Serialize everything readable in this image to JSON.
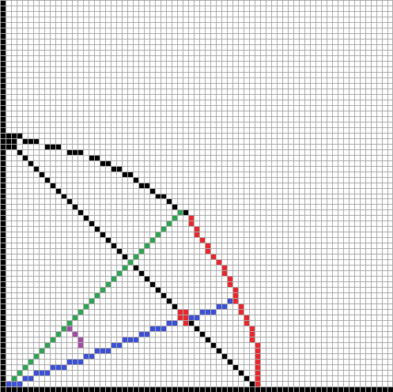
{
  "grid": {
    "columns": 71,
    "rows": 71,
    "background": "#ffffff",
    "line_color": "#a9a9a9"
  },
  "palette": {
    "black": "#000000",
    "red": "#e8262b",
    "green": "#2ea352",
    "blue": "#3a4fd6",
    "purple": "#a14aa6"
  },
  "layers": [
    {
      "name": "border-left",
      "color": "black",
      "cells": [
        [
          0,
          0
        ],
        [
          0,
          1
        ],
        [
          0,
          2
        ],
        [
          0,
          3
        ],
        [
          0,
          4
        ],
        [
          0,
          5
        ],
        [
          0,
          6
        ],
        [
          0,
          7
        ],
        [
          0,
          8
        ],
        [
          0,
          9
        ],
        [
          0,
          10
        ],
        [
          0,
          11
        ],
        [
          0,
          12
        ],
        [
          0,
          13
        ],
        [
          0,
          14
        ],
        [
          0,
          15
        ],
        [
          0,
          16
        ],
        [
          0,
          17
        ],
        [
          0,
          18
        ],
        [
          0,
          19
        ],
        [
          0,
          20
        ],
        [
          0,
          21
        ],
        [
          0,
          22
        ],
        [
          0,
          23
        ],
        [
          0,
          24
        ],
        [
          0,
          25
        ],
        [
          0,
          26
        ],
        [
          0,
          27
        ],
        [
          0,
          28
        ],
        [
          0,
          29
        ],
        [
          0,
          30
        ],
        [
          0,
          31
        ],
        [
          0,
          32
        ],
        [
          0,
          33
        ],
        [
          0,
          34
        ],
        [
          0,
          35
        ],
        [
          0,
          36
        ],
        [
          0,
          37
        ],
        [
          0,
          38
        ],
        [
          0,
          39
        ],
        [
          0,
          40
        ],
        [
          0,
          41
        ],
        [
          0,
          42
        ],
        [
          0,
          43
        ],
        [
          0,
          44
        ],
        [
          0,
          45
        ],
        [
          0,
          46
        ],
        [
          0,
          47
        ],
        [
          0,
          48
        ],
        [
          0,
          49
        ],
        [
          0,
          50
        ],
        [
          0,
          51
        ],
        [
          0,
          52
        ],
        [
          0,
          53
        ],
        [
          0,
          54
        ],
        [
          0,
          55
        ],
        [
          0,
          56
        ],
        [
          0,
          57
        ],
        [
          0,
          58
        ],
        [
          0,
          59
        ],
        [
          0,
          60
        ],
        [
          0,
          61
        ],
        [
          0,
          62
        ],
        [
          0,
          63
        ],
        [
          0,
          64
        ],
        [
          0,
          65
        ],
        [
          0,
          66
        ],
        [
          0,
          67
        ],
        [
          0,
          68
        ],
        [
          0,
          69
        ],
        [
          0,
          70
        ]
      ]
    },
    {
      "name": "border-bottom",
      "color": "black",
      "cells": [
        [
          1,
          70
        ],
        [
          2,
          70
        ],
        [
          3,
          70
        ],
        [
          4,
          70
        ],
        [
          5,
          70
        ],
        [
          6,
          70
        ],
        [
          7,
          70
        ],
        [
          8,
          70
        ],
        [
          9,
          70
        ],
        [
          10,
          70
        ],
        [
          11,
          70
        ],
        [
          12,
          70
        ],
        [
          13,
          70
        ],
        [
          14,
          70
        ],
        [
          15,
          70
        ],
        [
          16,
          70
        ],
        [
          17,
          70
        ],
        [
          18,
          70
        ],
        [
          19,
          70
        ],
        [
          20,
          70
        ],
        [
          21,
          70
        ],
        [
          22,
          70
        ],
        [
          23,
          70
        ],
        [
          24,
          70
        ],
        [
          25,
          70
        ],
        [
          26,
          70
        ],
        [
          27,
          70
        ],
        [
          28,
          70
        ],
        [
          29,
          70
        ],
        [
          30,
          70
        ],
        [
          31,
          70
        ],
        [
          32,
          70
        ],
        [
          33,
          70
        ],
        [
          34,
          70
        ],
        [
          35,
          70
        ],
        [
          36,
          70
        ],
        [
          37,
          70
        ],
        [
          38,
          70
        ],
        [
          39,
          70
        ],
        [
          40,
          70
        ],
        [
          41,
          70
        ],
        [
          42,
          70
        ],
        [
          43,
          70
        ],
        [
          44,
          70
        ],
        [
          45,
          70
        ],
        [
          46,
          70
        ],
        [
          47,
          70
        ],
        [
          48,
          70
        ],
        [
          49,
          70
        ],
        [
          50,
          70
        ],
        [
          51,
          70
        ],
        [
          52,
          70
        ],
        [
          53,
          70
        ],
        [
          54,
          70
        ],
        [
          55,
          70
        ],
        [
          56,
          70
        ],
        [
          57,
          70
        ],
        [
          58,
          70
        ],
        [
          59,
          70
        ],
        [
          60,
          70
        ],
        [
          61,
          70
        ],
        [
          62,
          70
        ],
        [
          63,
          70
        ],
        [
          64,
          70
        ],
        [
          65,
          70
        ],
        [
          66,
          70
        ],
        [
          67,
          70
        ],
        [
          68,
          70
        ],
        [
          69,
          70
        ],
        [
          70,
          70
        ]
      ]
    },
    {
      "name": "black-arc",
      "color": "black",
      "cells": [
        [
          1,
          24
        ],
        [
          2,
          24
        ],
        [
          3,
          24
        ],
        [
          1,
          25
        ],
        [
          2,
          25
        ],
        [
          4,
          25
        ],
        [
          5,
          25
        ],
        [
          6,
          25
        ],
        [
          8,
          26
        ],
        [
          9,
          26
        ],
        [
          10,
          26
        ],
        [
          12,
          27
        ],
        [
          13,
          27
        ],
        [
          14,
          27
        ],
        [
          16,
          28
        ],
        [
          17,
          28
        ],
        [
          18,
          29
        ],
        [
          19,
          29
        ],
        [
          20,
          30
        ],
        [
          21,
          30
        ],
        [
          22,
          31
        ],
        [
          23,
          31
        ],
        [
          24,
          32
        ],
        [
          25,
          33
        ],
        [
          26,
          33
        ],
        [
          27,
          34
        ],
        [
          28,
          35
        ],
        [
          29,
          35
        ],
        [
          30,
          36
        ],
        [
          31,
          37
        ],
        [
          32,
          38
        ],
        [
          33,
          38
        ]
      ]
    },
    {
      "name": "black-diagonal",
      "color": "black",
      "cells": [
        [
          1,
          26
        ],
        [
          2,
          26
        ],
        [
          3,
          27
        ],
        [
          4,
          28
        ],
        [
          5,
          29
        ],
        [
          6,
          30
        ],
        [
          7,
          31
        ],
        [
          8,
          32
        ],
        [
          9,
          33
        ],
        [
          10,
          34
        ],
        [
          11,
          35
        ],
        [
          12,
          36
        ],
        [
          13,
          37
        ],
        [
          14,
          38
        ],
        [
          15,
          39
        ],
        [
          16,
          40
        ],
        [
          17,
          41
        ],
        [
          18,
          42
        ],
        [
          19,
          43
        ],
        [
          20,
          44
        ],
        [
          21,
          45
        ],
        [
          22,
          46
        ],
        [
          23,
          47
        ],
        [
          24,
          48
        ],
        [
          25,
          49
        ],
        [
          26,
          50
        ],
        [
          27,
          51
        ],
        [
          28,
          52
        ],
        [
          29,
          53
        ],
        [
          30,
          54
        ],
        [
          31,
          55
        ],
        [
          32,
          56
        ],
        [
          33,
          57
        ],
        [
          34,
          58
        ],
        [
          35,
          59
        ],
        [
          36,
          60
        ],
        [
          37,
          61
        ],
        [
          38,
          62
        ],
        [
          39,
          63
        ],
        [
          40,
          64
        ],
        [
          41,
          65
        ],
        [
          42,
          66
        ],
        [
          43,
          67
        ],
        [
          44,
          68
        ],
        [
          45,
          69
        ]
      ]
    },
    {
      "name": "red-arc",
      "color": "red",
      "cells": [
        [
          34,
          39
        ],
        [
          34,
          40
        ],
        [
          35,
          41
        ],
        [
          35,
          42
        ],
        [
          36,
          43
        ],
        [
          37,
          44
        ],
        [
          37,
          45
        ],
        [
          38,
          46
        ],
        [
          39,
          47
        ],
        [
          40,
          48
        ],
        [
          40,
          49
        ],
        [
          41,
          50
        ],
        [
          41,
          51
        ],
        [
          42,
          52
        ],
        [
          42,
          53
        ],
        [
          42,
          54
        ],
        [
          43,
          55
        ],
        [
          43,
          56
        ],
        [
          44,
          57
        ],
        [
          44,
          58
        ],
        [
          45,
          59
        ],
        [
          45,
          60
        ],
        [
          45,
          61
        ],
        [
          46,
          62
        ],
        [
          46,
          63
        ],
        [
          46,
          64
        ],
        [
          46,
          65
        ],
        [
          46,
          66
        ],
        [
          46,
          67
        ],
        [
          46,
          68
        ],
        [
          46,
          69
        ],
        [
          32,
          56
        ],
        [
          33,
          56
        ],
        [
          32,
          57
        ],
        [
          33,
          57
        ],
        [
          34,
          57
        ],
        [
          33,
          58
        ]
      ]
    },
    {
      "name": "green-line",
      "color": "green",
      "cells": [
        [
          32,
          38
        ],
        [
          31,
          39
        ],
        [
          30,
          40
        ],
        [
          29,
          41
        ],
        [
          28,
          42
        ],
        [
          27,
          43
        ],
        [
          26,
          44
        ],
        [
          25,
          45
        ],
        [
          24,
          46
        ],
        [
          23,
          47
        ],
        [
          22,
          48
        ],
        [
          21,
          49
        ],
        [
          20,
          50
        ],
        [
          19,
          51
        ],
        [
          18,
          52
        ],
        [
          17,
          53
        ],
        [
          16,
          54
        ],
        [
          15,
          55
        ],
        [
          14,
          56
        ],
        [
          13,
          57
        ],
        [
          12,
          58
        ],
        [
          11,
          59
        ],
        [
          10,
          60
        ],
        [
          9,
          61
        ],
        [
          8,
          62
        ],
        [
          7,
          63
        ],
        [
          6,
          64
        ],
        [
          5,
          65
        ],
        [
          4,
          66
        ],
        [
          3,
          67
        ],
        [
          2,
          68
        ],
        [
          1,
          69
        ]
      ]
    },
    {
      "name": "blue-line",
      "color": "blue",
      "cells": [
        [
          41,
          54
        ],
        [
          40,
          55
        ],
        [
          39,
          55
        ],
        [
          38,
          56
        ],
        [
          37,
          56
        ],
        [
          36,
          56
        ],
        [
          35,
          57
        ],
        [
          34,
          57
        ],
        [
          31,
          58
        ],
        [
          30,
          58
        ],
        [
          29,
          59
        ],
        [
          28,
          59
        ],
        [
          27,
          59
        ],
        [
          26,
          60
        ],
        [
          25,
          60
        ],
        [
          24,
          61
        ],
        [
          23,
          61
        ],
        [
          22,
          61
        ],
        [
          21,
          62
        ],
        [
          20,
          62
        ],
        [
          19,
          63
        ],
        [
          18,
          63
        ],
        [
          17,
          63
        ],
        [
          16,
          64
        ],
        [
          15,
          64
        ],
        [
          14,
          65
        ],
        [
          13,
          65
        ],
        [
          12,
          65
        ],
        [
          11,
          66
        ],
        [
          10,
          66
        ],
        [
          9,
          66
        ],
        [
          8,
          67
        ],
        [
          7,
          67
        ],
        [
          6,
          67
        ],
        [
          5,
          68
        ],
        [
          4,
          68
        ],
        [
          3,
          69
        ],
        [
          2,
          69
        ],
        [
          1,
          69
        ]
      ]
    },
    {
      "name": "purple-angle",
      "color": "purple",
      "cells": [
        [
          12,
          59
        ],
        [
          13,
          60
        ],
        [
          14,
          61
        ],
        [
          14,
          62
        ]
      ]
    }
  ]
}
